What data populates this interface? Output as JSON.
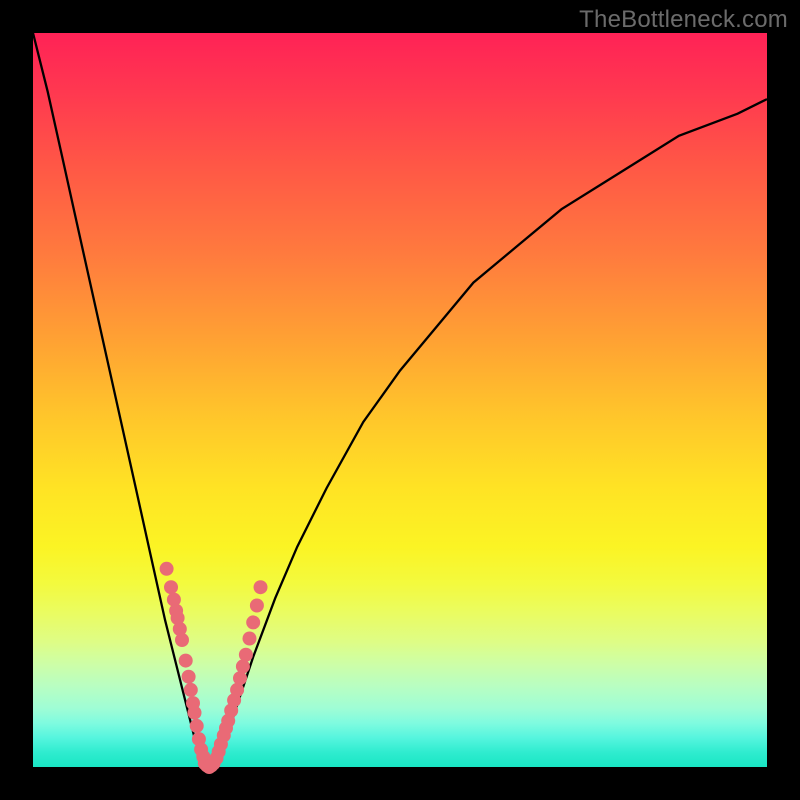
{
  "watermark": "TheBottleneck.com",
  "colors": {
    "frame": "#000000",
    "curve": "#000000",
    "dot": "#e96a76",
    "gradient_top": "#ff2256",
    "gradient_bottom": "#19e6c4"
  },
  "chart_data": {
    "type": "line",
    "title": "",
    "xlabel": "",
    "ylabel": "",
    "xlim": [
      0,
      100
    ],
    "ylim": [
      0,
      100
    ],
    "optimum_x": 24,
    "series": [
      {
        "name": "bottleneck-curve",
        "x": [
          0,
          2,
          4,
          6,
          8,
          10,
          12,
          14,
          16,
          18,
          20,
          22,
          23,
          24,
          25,
          26,
          28,
          30,
          33,
          36,
          40,
          45,
          50,
          55,
          60,
          66,
          72,
          80,
          88,
          96,
          100
        ],
        "y": [
          100,
          92,
          83,
          74,
          65,
          56,
          47,
          38,
          29,
          20,
          12,
          4,
          1,
          0,
          1,
          3,
          9,
          15,
          23,
          30,
          38,
          47,
          54,
          60,
          66,
          71,
          76,
          81,
          86,
          89,
          91
        ]
      },
      {
        "name": "sample-dots-left",
        "x": [
          18.2,
          18.8,
          19.2,
          19.5,
          19.7,
          20.0,
          20.3,
          20.8,
          21.2,
          21.5,
          21.8,
          22.0,
          22.3,
          22.6,
          22.9,
          23.2
        ],
        "y": [
          27.0,
          24.5,
          22.8,
          21.3,
          20.3,
          18.8,
          17.3,
          14.5,
          12.3,
          10.5,
          8.7,
          7.4,
          5.6,
          3.8,
          2.4,
          1.4
        ]
      },
      {
        "name": "sample-dots-right",
        "x": [
          25.0,
          25.3,
          25.6,
          26.0,
          26.3,
          26.6,
          27.0,
          27.4,
          27.8,
          28.2,
          28.6,
          29.0,
          29.5,
          30.0,
          30.5,
          31.0
        ],
        "y": [
          1.2,
          2.1,
          3.1,
          4.3,
          5.3,
          6.3,
          7.7,
          9.1,
          10.5,
          12.1,
          13.7,
          15.3,
          17.5,
          19.7,
          22.0,
          24.5
        ]
      },
      {
        "name": "sample-dots-bottom",
        "x": [
          23.4,
          23.7,
          24.0,
          24.3,
          24.6
        ],
        "y": [
          0.5,
          0.2,
          0.0,
          0.2,
          0.5
        ]
      }
    ]
  }
}
